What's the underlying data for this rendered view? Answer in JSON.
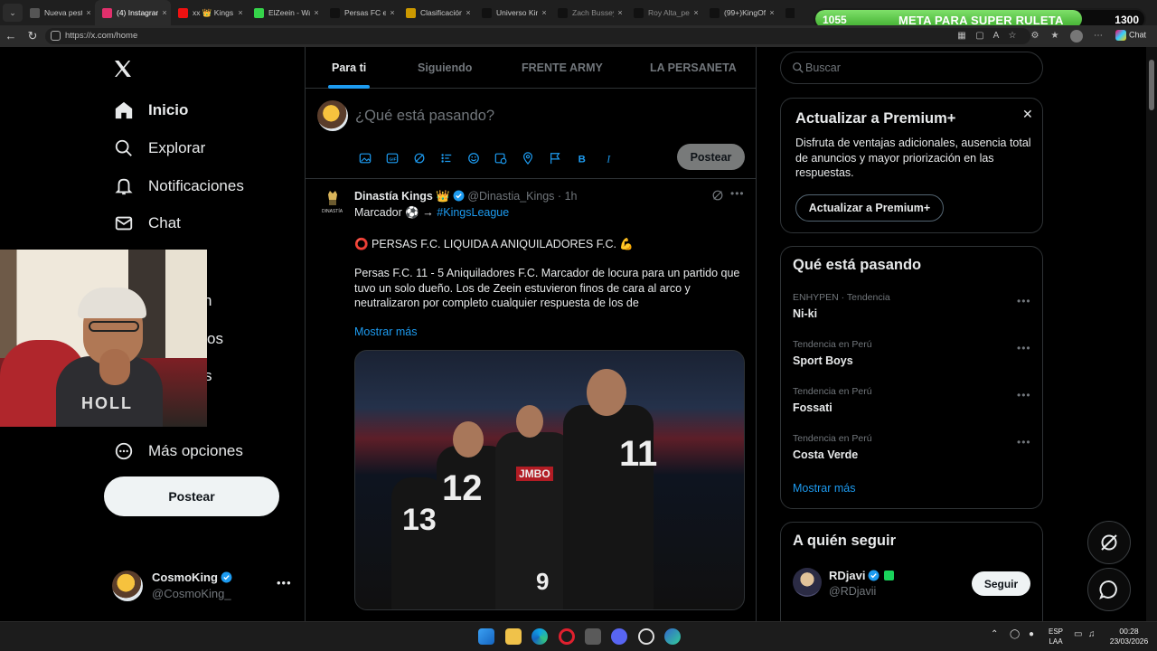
{
  "browser": {
    "tabs": [
      {
        "label": "Nueva pestaña",
        "width": 80
      },
      {
        "label": "(4) Instagram",
        "width": 84,
        "active": true
      },
      {
        "label": "xx 👑 Kings",
        "width": 84
      },
      {
        "label": "ElZeein - Wa",
        "width": 84
      },
      {
        "label": "Persas FC en",
        "width": 84
      },
      {
        "label": "Clasificación",
        "width": 84
      },
      {
        "label": "Universo King",
        "width": 84
      },
      {
        "label": "Zach Bussey",
        "width": 84
      },
      {
        "label": "Roy Alta_pe",
        "width": 84
      },
      {
        "label": "(99+)KingOff",
        "width": 84
      },
      {
        "label": "K",
        "width": 18
      }
    ],
    "url": "https://x.com/home",
    "chat_label": "Chat"
  },
  "stream_overlay": {
    "title": "META PARA SUPER RULETA",
    "current": "1055",
    "goal": "1300",
    "progress": 0.811
  },
  "nav": {
    "items": [
      {
        "label": "Inicio",
        "icon": "home-icon"
      },
      {
        "label": "Explorar",
        "icon": "search-icon"
      },
      {
        "label": "Notificaciones",
        "icon": "bell-icon"
      },
      {
        "label": "Chat",
        "icon": "mail-icon"
      }
    ],
    "hidden_fragments": [
      "n",
      "os",
      "s"
    ],
    "more_label": "Más opciones",
    "post_label": "Postear"
  },
  "me": {
    "name": "CosmoKing",
    "handle": "@CosmoKing_"
  },
  "feed_tabs": [
    "Para ti",
    "Siguiendo",
    "FRENTE ARMY",
    "LA PERSANETA"
  ],
  "composer": {
    "placeholder": "¿Qué está pasando?",
    "post_label": "Postear"
  },
  "tweet": {
    "name": "Dinastía Kings 👑",
    "handle": "@Dinastia_Kings",
    "time": "1h",
    "line1_prefix": "Marcador ⚽ → ",
    "hashtag": "#KingsLeague",
    "headline": "⭕ PERSAS F.C. LIQUIDA A ANIQUILADORES F.C. 💪",
    "body": "Persas F.C. 11 - 5 Aniquiladores F.C. Marcador de locura para un partido que tuvo un solo dueño. Los de Zeein estuvieron finos de cara al arco y neutralizaron por completo cualquier respuesta de los de",
    "show_more": "Mostrar más",
    "avatar_caption": "DINASTÍA",
    "jersey_numbers": [
      "12",
      "11",
      "13",
      "9"
    ],
    "shirt_sponsor": "JMBO"
  },
  "search": {
    "placeholder": "Buscar"
  },
  "premium": {
    "title": "Actualizar a Premium+",
    "text": "Disfruta de ventajas adicionales, ausencia total de anuncios y mayor priorización en las respuestas.",
    "button": "Actualizar a Premium+"
  },
  "trends": {
    "title": "Qué está pasando",
    "items": [
      {
        "category": "ENHYPEN · Tendencia",
        "name": "Ni-ki"
      },
      {
        "category": "Tendencia en Perú",
        "name": "Sport Boys"
      },
      {
        "category": "Tendencia en Perú",
        "name": "Fossati"
      },
      {
        "category": "Tendencia en Perú",
        "name": "Costa Verde"
      }
    ],
    "show_more": "Mostrar más"
  },
  "who_to_follow": {
    "title": "A quién seguir",
    "user": {
      "name": "RDjavi",
      "handle": "@RDjavii",
      "button": "Seguir"
    }
  },
  "taskbar": {
    "lang_top": "ESP",
    "lang_bottom": "LAA",
    "time": "00:28",
    "date": "23/03/2026"
  },
  "webcam_shirt_text": "HOLL"
}
